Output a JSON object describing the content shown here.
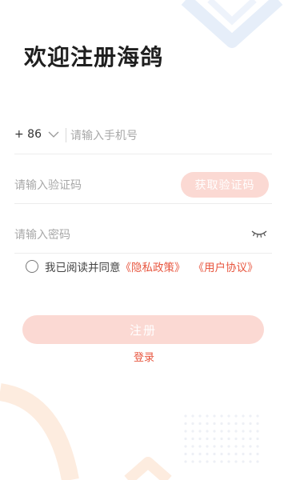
{
  "page": {
    "title": "欢迎注册海鸽"
  },
  "form": {
    "country_code": "+ 86",
    "phone_placeholder": "请输入手机号",
    "code_placeholder": "请输入验证码",
    "get_code_label": "获取验证码",
    "password_placeholder": "请输入密码"
  },
  "agreement": {
    "checked": false,
    "prefix": "我已阅读并同意",
    "privacy_link": "《隐私政策》",
    "terms_link": "《用户协议》"
  },
  "actions": {
    "register_label": "注册",
    "login_label": "登录"
  },
  "colors": {
    "accent": "#e8563f",
    "button_disabled_bg": "#fbd9d3",
    "decor_blue": "#e6eef9",
    "decor_peach": "#fdecdf"
  },
  "icons": {
    "country_dropdown": "chevron-down-icon",
    "password_visibility": "eye-closed-icon",
    "agreement_checkbox": "radio-circle-icon"
  }
}
